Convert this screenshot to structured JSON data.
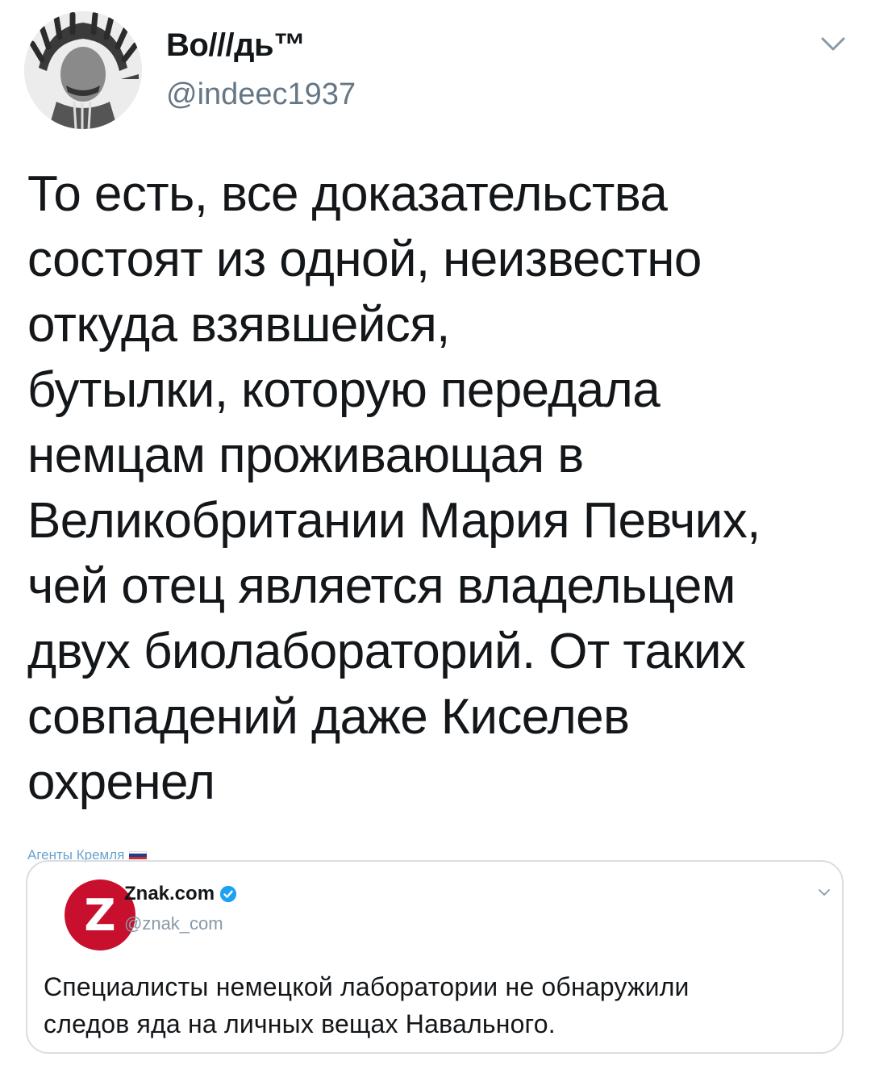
{
  "tweet": {
    "author": {
      "display_name": "Во///дь™",
      "handle": "@indeec1937",
      "avatar_icon": "portrait-with-headdress-avatar"
    },
    "menu_icon": "chevron-down-icon",
    "text_lines": [
      "То есть, все доказательства",
      "состоят из одной, неизвестно",
      "откуда взявшейся,",
      "бутылки, которую передала",
      "немцам проживающая в",
      "Великобритании Мария Певчих,",
      "чей отец является владельцем",
      "двух биолабораторий. От таких",
      "совпадений даже Киселев",
      "охренел"
    ]
  },
  "watermark": {
    "text": "Агенты Кремля",
    "flag_colors": [
      "#ffffff",
      "#1c3f94",
      "#d52b1e"
    ]
  },
  "quoted_tweet": {
    "author": {
      "display_name": "Znak.com",
      "handle": "@znak_com",
      "avatar_letter": "Z",
      "verified": true
    },
    "menu_icon": "chevron-down-icon",
    "text_lines": [
      "Специалисты немецкой лаборатории не обнаружили",
      "следов яда на личных вещах Навального."
    ]
  },
  "colors": {
    "text": "#14171a",
    "secondary": "#657786",
    "verified_blue": "#1da1f2",
    "znak_red": "#c8102e",
    "border": "#dadde1"
  }
}
